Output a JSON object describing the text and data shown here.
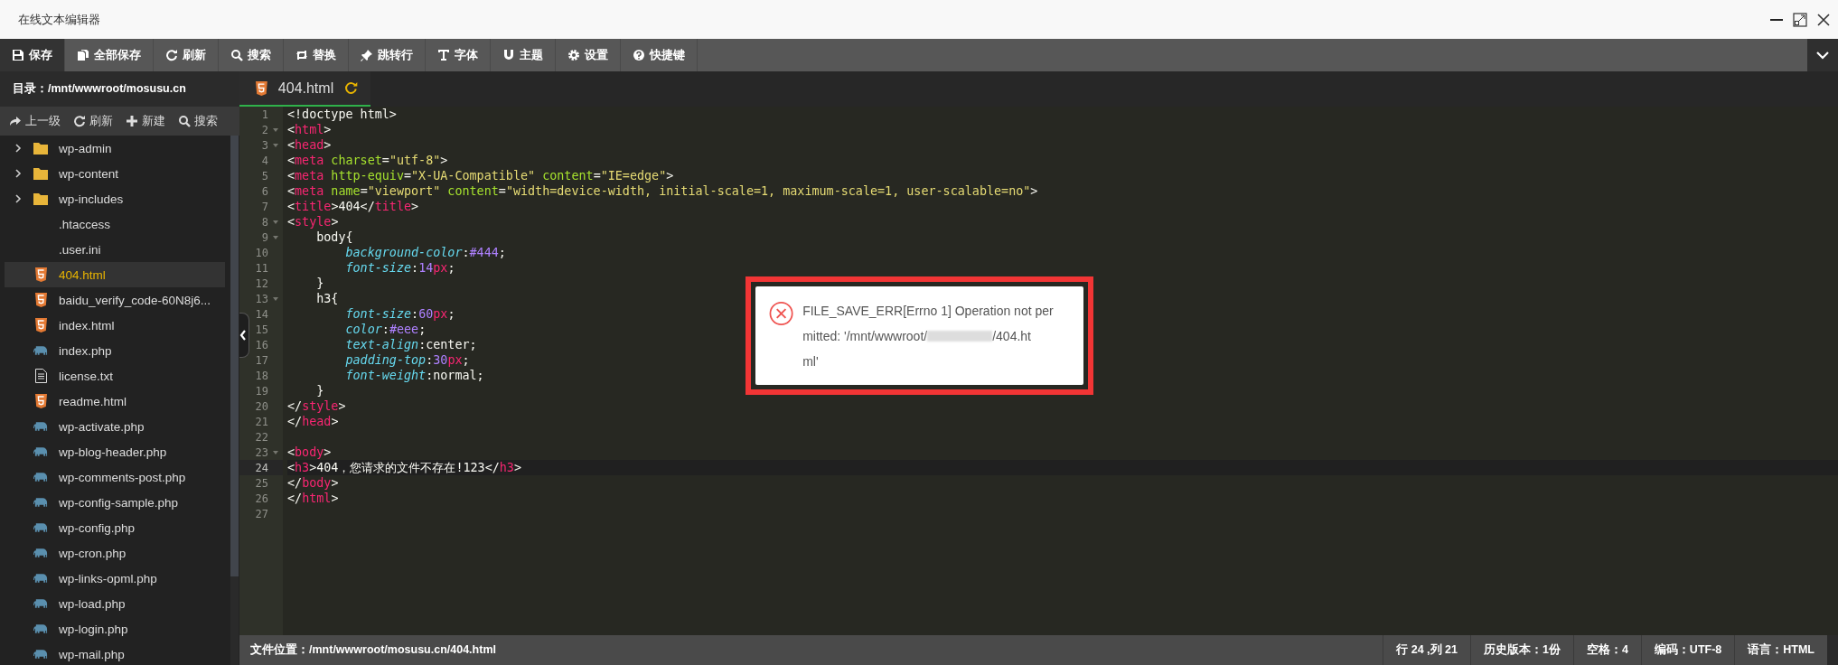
{
  "window": {
    "title": "在线文本编辑器"
  },
  "toolbar": [
    {
      "label": "保存",
      "selected": true
    },
    {
      "label": "全部保存",
      "selected": false
    },
    {
      "label": "刷新",
      "selected": false
    },
    {
      "label": "搜索",
      "selected": false
    },
    {
      "label": "替换",
      "selected": false
    },
    {
      "label": "跳转行",
      "selected": false
    },
    {
      "label": "字体",
      "selected": false
    },
    {
      "label": "主题",
      "selected": false
    },
    {
      "label": "设置",
      "selected": false
    },
    {
      "label": "快捷键",
      "selected": false
    }
  ],
  "sidebar": {
    "directory": "目录：/mnt/wwwroot/mosusu.cn",
    "actions": [
      {
        "label": "上一级"
      },
      {
        "label": "刷新"
      },
      {
        "label": "新建"
      },
      {
        "label": "搜索"
      }
    ],
    "files": [
      {
        "name": "wp-admin",
        "kind": "folder",
        "expanded": false,
        "selected": false
      },
      {
        "name": "wp-content",
        "kind": "folder",
        "expanded": false,
        "selected": false
      },
      {
        "name": "wp-includes",
        "kind": "folder",
        "expanded": false,
        "selected": false
      },
      {
        "name": ".htaccess",
        "kind": "plain",
        "selected": false
      },
      {
        "name": ".user.ini",
        "kind": "plain",
        "selected": false
      },
      {
        "name": "404.html",
        "kind": "html",
        "selected": true
      },
      {
        "name": "baidu_verify_code-60N8j6...",
        "kind": "html",
        "selected": false
      },
      {
        "name": "index.html",
        "kind": "html",
        "selected": false
      },
      {
        "name": "index.php",
        "kind": "php",
        "selected": false
      },
      {
        "name": "license.txt",
        "kind": "text",
        "selected": false
      },
      {
        "name": "readme.html",
        "kind": "html",
        "selected": false
      },
      {
        "name": "wp-activate.php",
        "kind": "php",
        "selected": false
      },
      {
        "name": "wp-blog-header.php",
        "kind": "php",
        "selected": false
      },
      {
        "name": "wp-comments-post.php",
        "kind": "php",
        "selected": false
      },
      {
        "name": "wp-config-sample.php",
        "kind": "php",
        "selected": false
      },
      {
        "name": "wp-config.php",
        "kind": "php",
        "selected": false
      },
      {
        "name": "wp-cron.php",
        "kind": "php",
        "selected": false
      },
      {
        "name": "wp-links-opml.php",
        "kind": "php",
        "selected": false
      },
      {
        "name": "wp-load.php",
        "kind": "php",
        "selected": false
      },
      {
        "name": "wp-login.php",
        "kind": "php",
        "selected": false
      },
      {
        "name": "wp-mail.php",
        "kind": "php",
        "selected": false
      }
    ]
  },
  "tabs": [
    {
      "label": "404.html",
      "kind": "html",
      "selected": true,
      "reloadable": true
    }
  ],
  "editor": {
    "lines": [
      {
        "number": "1",
        "foldable": false,
        "active": false,
        "tokens": [
          {
            "kind": "text",
            "text": "<!doctype html>"
          }
        ]
      },
      {
        "number": "2",
        "foldable": true,
        "active": false,
        "tokens": [
          {
            "kind": "text",
            "text": "<"
          },
          {
            "kind": "tag",
            "text": "html"
          },
          {
            "kind": "text",
            "text": ">"
          }
        ]
      },
      {
        "number": "3",
        "foldable": true,
        "active": false,
        "tokens": [
          {
            "kind": "text",
            "text": "<"
          },
          {
            "kind": "tag",
            "text": "head"
          },
          {
            "kind": "text",
            "text": ">"
          }
        ]
      },
      {
        "number": "4",
        "foldable": false,
        "active": false,
        "tokens": [
          {
            "kind": "text",
            "text": "<"
          },
          {
            "kind": "tag",
            "text": "meta"
          },
          {
            "kind": "attr",
            "text": " charset"
          },
          {
            "kind": "text",
            "text": "="
          },
          {
            "kind": "string",
            "text": "\"utf-8\""
          },
          {
            "kind": "text",
            "text": ">"
          }
        ]
      },
      {
        "number": "5",
        "foldable": false,
        "active": false,
        "tokens": [
          {
            "kind": "text",
            "text": "<"
          },
          {
            "kind": "tag",
            "text": "meta"
          },
          {
            "kind": "attr",
            "text": " http-equiv"
          },
          {
            "kind": "text",
            "text": "="
          },
          {
            "kind": "string",
            "text": "\"X-UA-Compatible\""
          },
          {
            "kind": "attr",
            "text": " content"
          },
          {
            "kind": "text",
            "text": "="
          },
          {
            "kind": "string",
            "text": "\"IE=edge\""
          },
          {
            "kind": "text",
            "text": ">"
          }
        ]
      },
      {
        "number": "6",
        "foldable": false,
        "active": false,
        "tokens": [
          {
            "kind": "text",
            "text": "<"
          },
          {
            "kind": "tag",
            "text": "meta"
          },
          {
            "kind": "attr",
            "text": " name"
          },
          {
            "kind": "text",
            "text": "="
          },
          {
            "kind": "string",
            "text": "\"viewport\""
          },
          {
            "kind": "attr",
            "text": " content"
          },
          {
            "kind": "text",
            "text": "="
          },
          {
            "kind": "string",
            "text": "\"width=device-width, initial-scale=1, maximum-scale=1, user-scalable=no\""
          },
          {
            "kind": "text",
            "text": ">"
          }
        ]
      },
      {
        "number": "7",
        "foldable": false,
        "active": false,
        "tokens": [
          {
            "kind": "text",
            "text": "<"
          },
          {
            "kind": "tag",
            "text": "title"
          },
          {
            "kind": "text",
            "text": ">404</"
          },
          {
            "kind": "tag",
            "text": "title"
          },
          {
            "kind": "text",
            "text": ">"
          }
        ]
      },
      {
        "number": "8",
        "foldable": true,
        "active": false,
        "tokens": [
          {
            "kind": "text",
            "text": "<"
          },
          {
            "kind": "tag",
            "text": "style"
          },
          {
            "kind": "text",
            "text": ">"
          }
        ]
      },
      {
        "number": "9",
        "foldable": true,
        "active": false,
        "tokens": [
          {
            "kind": "text",
            "text": "    body{"
          }
        ]
      },
      {
        "number": "10",
        "foldable": false,
        "active": false,
        "tokens": [
          {
            "kind": "property",
            "text": "        background-color"
          },
          {
            "kind": "text",
            "text": ":"
          },
          {
            "kind": "number",
            "text": "#444"
          },
          {
            "kind": "text",
            "text": ";"
          }
        ]
      },
      {
        "number": "11",
        "foldable": false,
        "active": false,
        "tokens": [
          {
            "kind": "property",
            "text": "        font-size"
          },
          {
            "kind": "text",
            "text": ":"
          },
          {
            "kind": "number",
            "text": "14"
          },
          {
            "kind": "tag",
            "text": "px"
          },
          {
            "kind": "text",
            "text": ";"
          }
        ]
      },
      {
        "number": "12",
        "foldable": false,
        "active": false,
        "tokens": [
          {
            "kind": "text",
            "text": "    }"
          }
        ]
      },
      {
        "number": "13",
        "foldable": true,
        "active": false,
        "tokens": [
          {
            "kind": "text",
            "text": "    h3{"
          }
        ]
      },
      {
        "number": "14",
        "foldable": false,
        "active": false,
        "tokens": [
          {
            "kind": "property",
            "text": "        font-size"
          },
          {
            "kind": "text",
            "text": ":"
          },
          {
            "kind": "number",
            "text": "60"
          },
          {
            "kind": "tag",
            "text": "px"
          },
          {
            "kind": "text",
            "text": ";"
          }
        ]
      },
      {
        "number": "15",
        "foldable": false,
        "active": false,
        "tokens": [
          {
            "kind": "property",
            "text": "        color"
          },
          {
            "kind": "text",
            "text": ":"
          },
          {
            "kind": "number",
            "text": "#eee"
          },
          {
            "kind": "text",
            "text": ";"
          }
        ]
      },
      {
        "number": "16",
        "foldable": false,
        "active": false,
        "tokens": [
          {
            "kind": "property",
            "text": "        text-align"
          },
          {
            "kind": "text",
            "text": ":center;"
          }
        ]
      },
      {
        "number": "17",
        "foldable": false,
        "active": false,
        "tokens": [
          {
            "kind": "property",
            "text": "        padding-top"
          },
          {
            "kind": "text",
            "text": ":"
          },
          {
            "kind": "number",
            "text": "30"
          },
          {
            "kind": "tag",
            "text": "px"
          },
          {
            "kind": "text",
            "text": ";"
          }
        ]
      },
      {
        "number": "18",
        "foldable": false,
        "active": false,
        "tokens": [
          {
            "kind": "property",
            "text": "        font-weight"
          },
          {
            "kind": "text",
            "text": ":normal;"
          }
        ]
      },
      {
        "number": "19",
        "foldable": false,
        "active": false,
        "tokens": [
          {
            "kind": "text",
            "text": "    }"
          }
        ]
      },
      {
        "number": "20",
        "foldable": false,
        "active": false,
        "tokens": [
          {
            "kind": "text",
            "text": "</"
          },
          {
            "kind": "tag",
            "text": "style"
          },
          {
            "kind": "text",
            "text": ">"
          }
        ]
      },
      {
        "number": "21",
        "foldable": false,
        "active": false,
        "tokens": [
          {
            "kind": "text",
            "text": "</"
          },
          {
            "kind": "tag",
            "text": "head"
          },
          {
            "kind": "text",
            "text": ">"
          }
        ]
      },
      {
        "number": "22",
        "foldable": false,
        "active": false
      },
      {
        "number": "23",
        "foldable": true,
        "active": false,
        "tokens": [
          {
            "kind": "text",
            "text": "<"
          },
          {
            "kind": "tag",
            "text": "body"
          },
          {
            "kind": "text",
            "text": ">"
          }
        ]
      },
      {
        "number": "24",
        "foldable": false,
        "active": true,
        "tokens": [
          {
            "kind": "text",
            "text": "<"
          },
          {
            "kind": "tag",
            "text": "h3"
          },
          {
            "kind": "text",
            "text": ">404，您请求的文件不存在!123</"
          },
          {
            "kind": "tag",
            "text": "h3"
          },
          {
            "kind": "text",
            "text": ">"
          }
        ]
      },
      {
        "number": "25",
        "foldable": false,
        "active": false,
        "tokens": [
          {
            "kind": "text",
            "text": "</"
          },
          {
            "kind": "tag",
            "text": "body"
          },
          {
            "kind": "text",
            "text": ">"
          }
        ]
      },
      {
        "number": "26",
        "foldable": false,
        "active": false,
        "tokens": [
          {
            "kind": "text",
            "text": "</"
          },
          {
            "kind": "tag",
            "text": "html"
          },
          {
            "kind": "text",
            "text": ">"
          }
        ]
      },
      {
        "number": "27",
        "foldable": false,
        "active": false
      }
    ]
  },
  "dialog": {
    "kind": "error",
    "redacted": true,
    "message_lines": [
      [
        "FILE_SAVE_ERR[Errno 1] Operation not per"
      ],
      [
        "mitted: '/mnt/wwwroot/",
        "/404.ht"
      ],
      [
        "ml'"
      ]
    ]
  },
  "status_bar": {
    "file_location": "文件位置：/mnt/wwwroot/mosusu.cn/404.html",
    "items": [
      "行 24 ,列 21",
      "历史版本：1份",
      "空格：4",
      "编码：UTF-8",
      "语言：HTML"
    ]
  }
}
